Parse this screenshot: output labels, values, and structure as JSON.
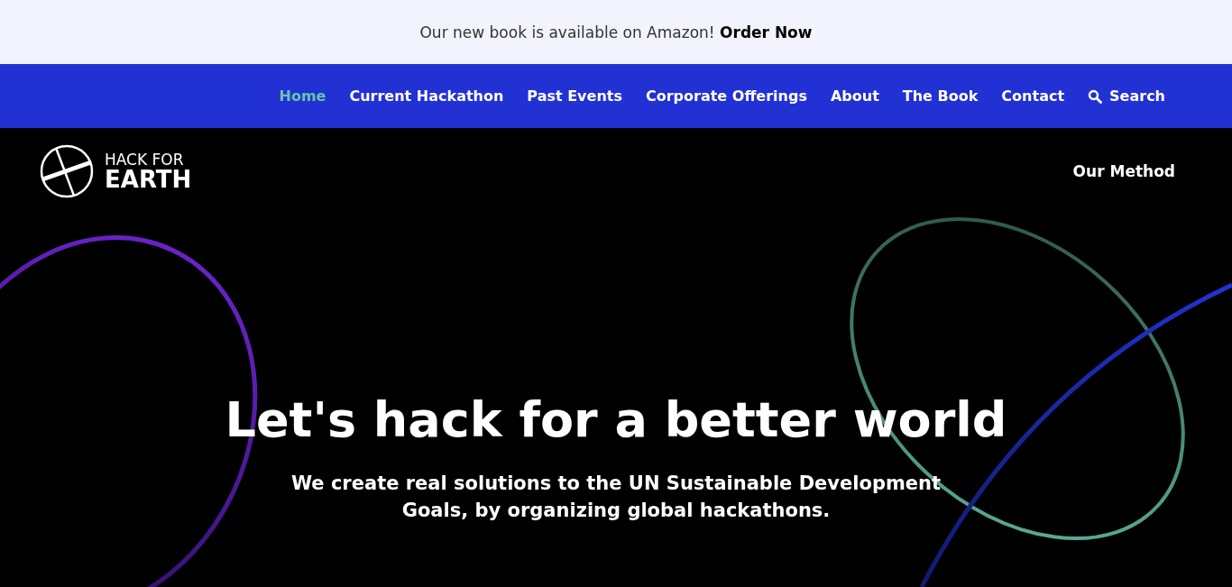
{
  "announcement": {
    "text": "Our new book is available on Amazon! **Order Now**"
  },
  "nav": {
    "items": [
      {
        "label": "Home",
        "selected": true
      },
      {
        "label": "Current Hackathon",
        "selected": false
      },
      {
        "label": "Past Events",
        "selected": false
      },
      {
        "label": "Corporate Offerings",
        "selected": false
      },
      {
        "label": "About",
        "selected": false
      },
      {
        "label": "The Book",
        "selected": false
      },
      {
        "label": "Contact",
        "selected": false
      }
    ],
    "search": "Search"
  },
  "header": {
    "logo_line1": "HACK FOR",
    "logo_line2": "EARTH",
    "link": "Our Method"
  },
  "hero": {
    "title": "Let's hack for a better world",
    "subtitle": "We create real solutions to the UN Sustainable Development Goals, by organizing global hackathons."
  }
}
